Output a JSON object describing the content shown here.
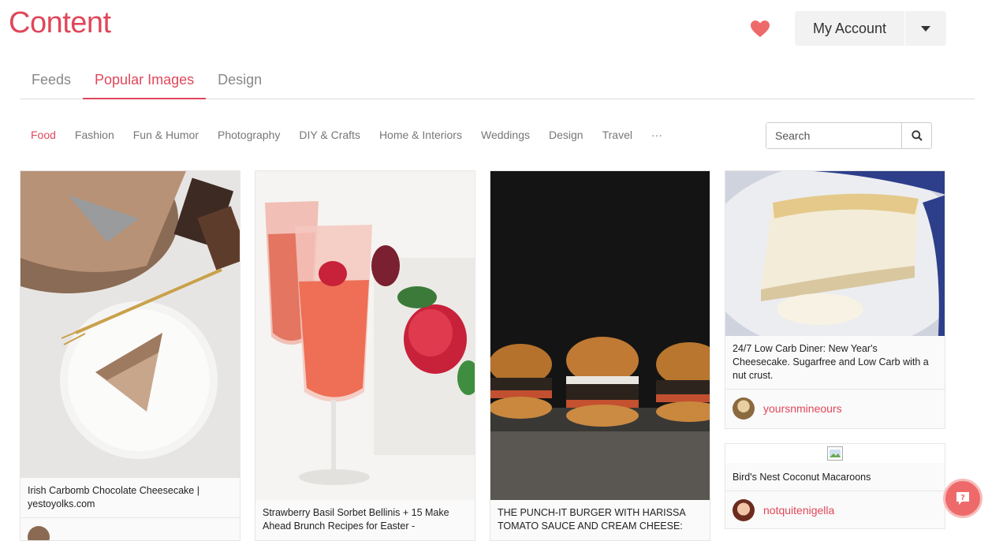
{
  "app": {
    "title": "Content"
  },
  "account": {
    "label": "My Account"
  },
  "tabs": [
    {
      "label": "Feeds"
    },
    {
      "label": "Popular Images"
    },
    {
      "label": "Design"
    }
  ],
  "categories": [
    {
      "label": "Food"
    },
    {
      "label": "Fashion"
    },
    {
      "label": "Fun & Humor"
    },
    {
      "label": "Photography"
    },
    {
      "label": "DIY & Crafts"
    },
    {
      "label": "Home & Interiors"
    },
    {
      "label": "Weddings"
    },
    {
      "label": "Design"
    },
    {
      "label": "Travel"
    },
    {
      "label": "···"
    }
  ],
  "search": {
    "placeholder": "Search"
  },
  "cards": [
    {
      "caption": "Irish Carbomb Chocolate Cheesecake | yestoyolks.com"
    },
    {
      "caption": "Strawberry Basil Sorbet Bellinis + 15 Make Ahead Brunch Recipes for Easter -"
    },
    {
      "caption": "THE PUNCH-IT BURGER WITH HARISSA TOMATO SAUCE AND CREAM CHEESE:"
    },
    {
      "caption": "24/7 Low Carb Diner: New Year's Cheesecake. Sugarfree and Low Carb with a nut crust.",
      "user": "yoursnmineours"
    },
    {
      "caption": "Bird's Nest Coconut Macaroons",
      "user": "notquitenigella"
    }
  ],
  "colors": {
    "accent": "#e0475a",
    "help": "#ee6a6a"
  },
  "icons": [
    "heart-icon",
    "chevron-down-icon",
    "search-icon",
    "help-chat-icon"
  ]
}
